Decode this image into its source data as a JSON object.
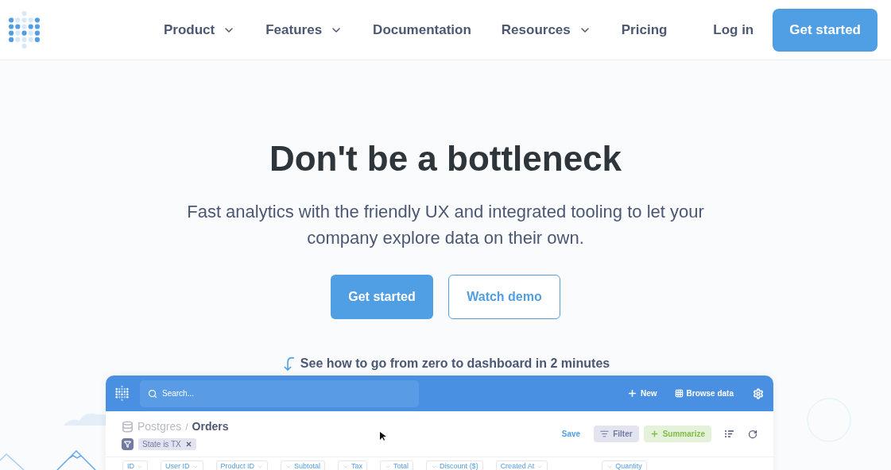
{
  "nav": {
    "items": [
      {
        "label": "Product",
        "dropdown": true
      },
      {
        "label": "Features",
        "dropdown": true
      },
      {
        "label": "Documentation",
        "dropdown": false
      },
      {
        "label": "Resources",
        "dropdown": true
      },
      {
        "label": "Pricing",
        "dropdown": false
      }
    ],
    "login": "Log in",
    "cta": "Get started"
  },
  "hero": {
    "title": "Don't be a bottleneck",
    "subtitle": "Fast analytics with the friendly UX and integrated tooling to let your company explore data on their own.",
    "primary": "Get started",
    "secondary": "Watch demo",
    "video_link": "See how to go from zero to dashboard in 2 minutes"
  },
  "app": {
    "search": {
      "placeholder": "Search..."
    },
    "new": "New",
    "browse": "Browse data",
    "breadcrumb": {
      "database": "Postgres",
      "separator": "/",
      "table": "Orders"
    },
    "filter_pill": "State is TX",
    "save": "Save",
    "filter": "Filter",
    "summarize": "Summarize",
    "columns": [
      {
        "label": "ID",
        "kind": "text"
      },
      {
        "label": "User ID",
        "kind": "text"
      },
      {
        "label": "Product ID",
        "kind": "text"
      },
      {
        "label": "Subtotal",
        "kind": "number"
      },
      {
        "label": "Tax",
        "kind": "number"
      },
      {
        "label": "Total",
        "kind": "number"
      },
      {
        "label": "Discount ($)",
        "kind": "number"
      },
      {
        "label": "Created At",
        "kind": "text"
      },
      {
        "label": "Quantity",
        "kind": "number"
      }
    ]
  }
}
